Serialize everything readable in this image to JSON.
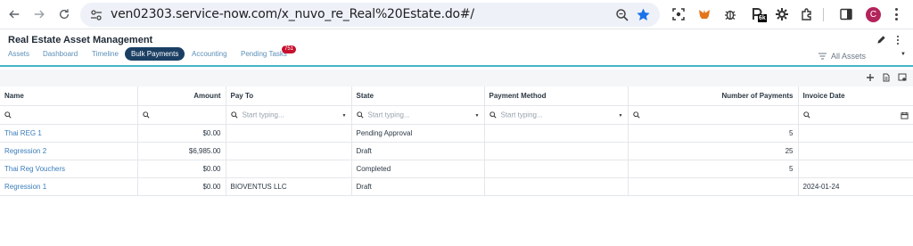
{
  "browser": {
    "url": "ven02303.service-now.com/x_nuvo_re_Real%20Estate.do#/",
    "profile_initial": "C",
    "extension_badge": "6k"
  },
  "app": {
    "title": "Real Estate Asset Management",
    "tabs": [
      {
        "label": "Assets"
      },
      {
        "label": "Dashboard"
      },
      {
        "label": "Timeline"
      },
      {
        "label": "Bulk Payments",
        "active": true
      },
      {
        "label": "Accounting"
      },
      {
        "label": "Pending Tasks",
        "badge": "751"
      }
    ],
    "filter_label": "All Assets",
    "accent_color": "#46b3c9",
    "active_tab_color": "#1b3f63",
    "badge_color": "#c8102e"
  },
  "table": {
    "columns": [
      {
        "label": "Name"
      },
      {
        "label": "Amount"
      },
      {
        "label": "Pay To"
      },
      {
        "label": "State"
      },
      {
        "label": "Payment Method"
      },
      {
        "label": "Number of Payments"
      },
      {
        "label": "Invoice Date"
      }
    ],
    "filters": {
      "pay_to_placeholder": "Start typing...",
      "state_placeholder": "Start typing...",
      "method_placeholder": "Start typing..."
    },
    "rows": [
      {
        "name": "Thai REG 1",
        "amount": "$0.00",
        "pay_to": "",
        "state": "Pending Approval",
        "method": "",
        "num": "5",
        "date": ""
      },
      {
        "name": "Regression 2",
        "amount": "$6,985.00",
        "pay_to": "",
        "state": "Draft",
        "method": "",
        "num": "25",
        "date": ""
      },
      {
        "name": "Thai Reg Vouchers",
        "amount": "$0.00",
        "pay_to": "",
        "state": "Completed",
        "method": "",
        "num": "5",
        "date": ""
      },
      {
        "name": "Regression 1",
        "amount": "$0.00",
        "pay_to": "BIOVENTUS LLC",
        "state": "Draft",
        "method": "",
        "num": "",
        "date": "2024-01-24"
      }
    ]
  }
}
